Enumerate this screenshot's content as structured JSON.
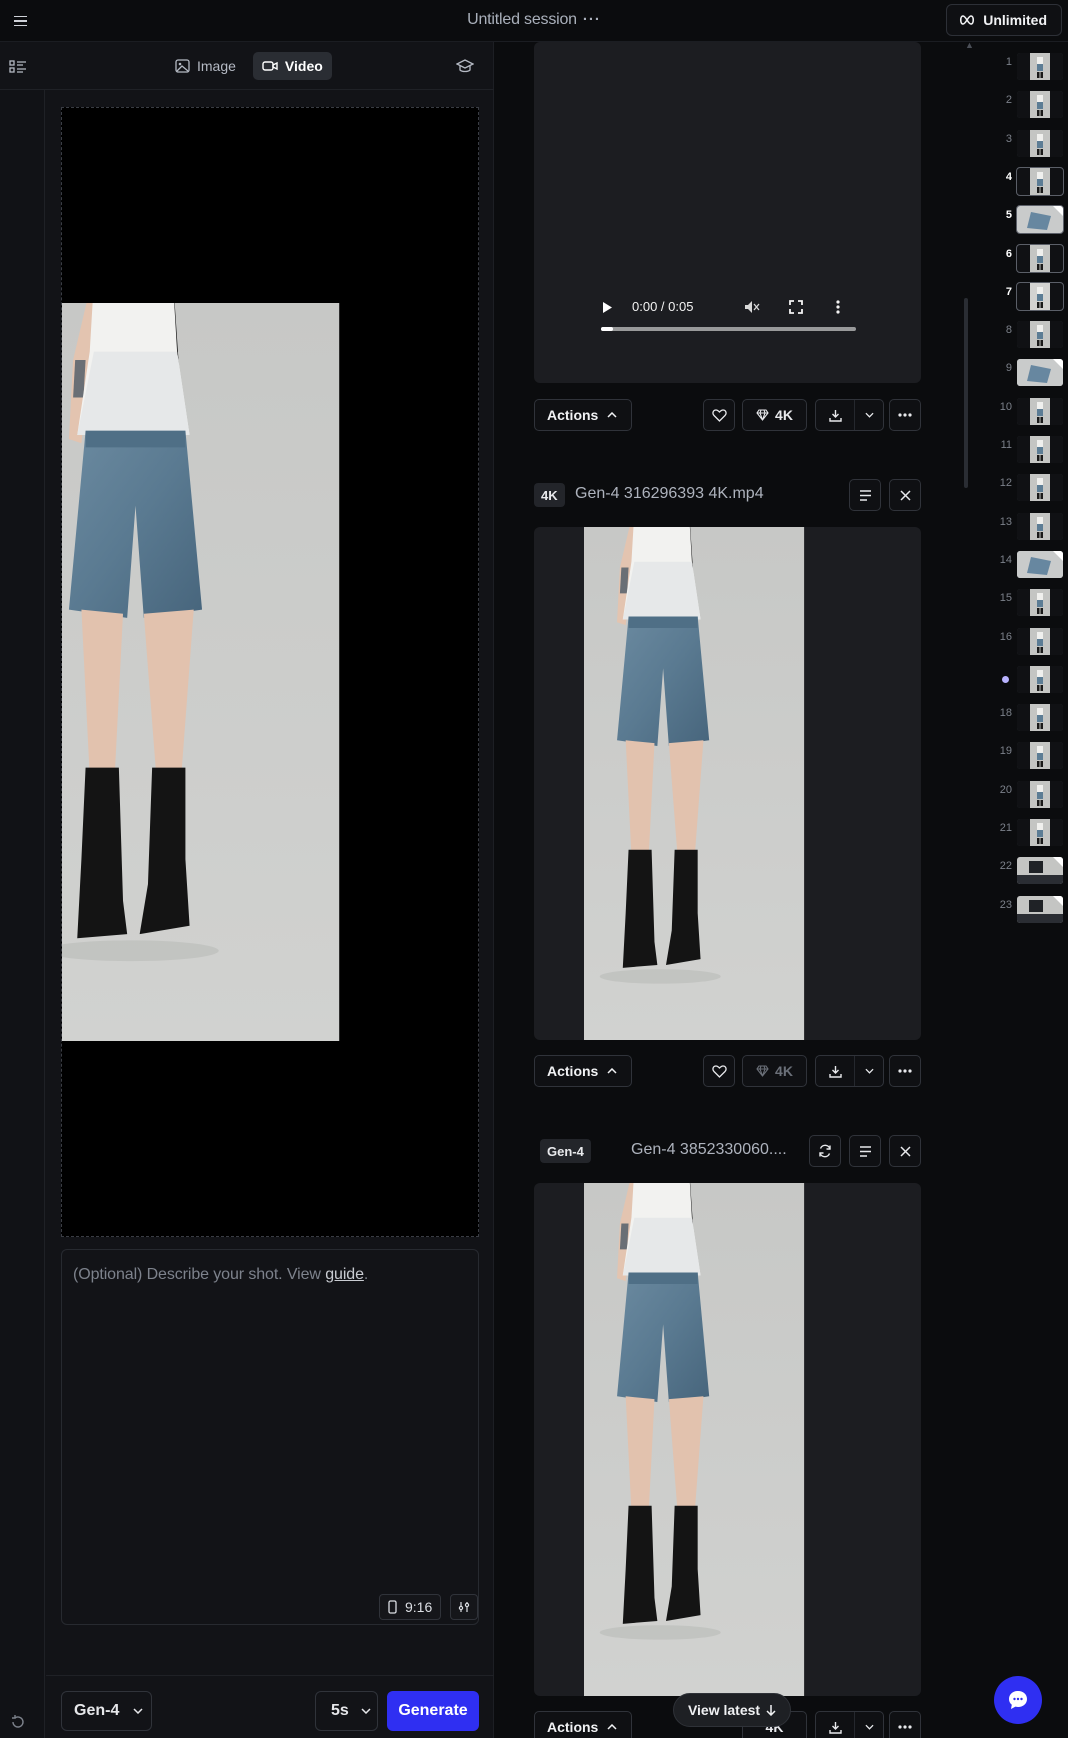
{
  "topbar": {
    "session_title": "Untitled session",
    "session_more": "···",
    "plan_label": "Unlimited",
    "plan_icon": "infinity-icon"
  },
  "left_panel": {
    "tabs": [
      {
        "label": "Image",
        "icon": "image-icon",
        "active": false
      },
      {
        "label": "Video",
        "icon": "video-camera-icon",
        "active": true
      }
    ],
    "prompt": {
      "placeholder": "(Optional) Describe your shot. View ",
      "guide_link": "guide",
      "suffix": "."
    },
    "aspect_ratio": "9:16",
    "model": "Gen-4",
    "duration": "5s",
    "generate_label": "Generate"
  },
  "feed": {
    "cards": [
      {
        "video": {
          "time": "0:00 / 0:05"
        },
        "actions_label": "Actions",
        "upscale_label": "4K",
        "upscale_enabled": true
      },
      {
        "tag": "4K",
        "file_name": "Gen-4 316296393 4K.mp4",
        "actions_label": "Actions",
        "upscale_label": "4K",
        "upscale_enabled": false
      },
      {
        "tag": "Gen-4",
        "file_name": "Gen-4 3852330060....",
        "actions_label": "Actions",
        "upscale_label": "4K",
        "upscale_enabled": true
      }
    ],
    "view_latest_label": "View latest"
  },
  "thumbnails": [
    {
      "n": "1",
      "bright": false,
      "type": "model"
    },
    {
      "n": "2",
      "bright": false,
      "type": "model"
    },
    {
      "n": "3",
      "bright": false,
      "type": "model"
    },
    {
      "n": "4",
      "bright": true,
      "type": "model"
    },
    {
      "n": "5",
      "bright": true,
      "type": "flat"
    },
    {
      "n": "6",
      "bright": true,
      "type": "model"
    },
    {
      "n": "7",
      "bright": true,
      "type": "light"
    },
    {
      "n": "8",
      "bright": false,
      "type": "model"
    },
    {
      "n": "9",
      "bright": false,
      "type": "flat"
    },
    {
      "n": "10",
      "bright": false,
      "type": "model"
    },
    {
      "n": "11",
      "bright": false,
      "type": "model"
    },
    {
      "n": "12",
      "bright": false,
      "type": "model"
    },
    {
      "n": "13",
      "bright": false,
      "type": "model"
    },
    {
      "n": "14",
      "bright": false,
      "type": "flat"
    },
    {
      "n": "15",
      "bright": false,
      "type": "model"
    },
    {
      "n": "16",
      "bright": false,
      "type": "model"
    },
    {
      "n": "",
      "bright": false,
      "type": "model",
      "current": true
    },
    {
      "n": "18",
      "bright": false,
      "type": "model"
    },
    {
      "n": "19",
      "bright": false,
      "type": "model"
    },
    {
      "n": "20",
      "bright": false,
      "type": "model"
    },
    {
      "n": "21",
      "bright": false,
      "type": "model"
    },
    {
      "n": "22",
      "bright": false,
      "type": "dark"
    },
    {
      "n": "23",
      "bright": false,
      "type": "dark"
    }
  ],
  "colors": {
    "accent": "#2f2ff2",
    "background": "#0b0c0e",
    "panel": "#121317",
    "studio_grey": "#c7c8c6",
    "denim": "#5d7d95",
    "current_dot": "#b9b3ff"
  }
}
